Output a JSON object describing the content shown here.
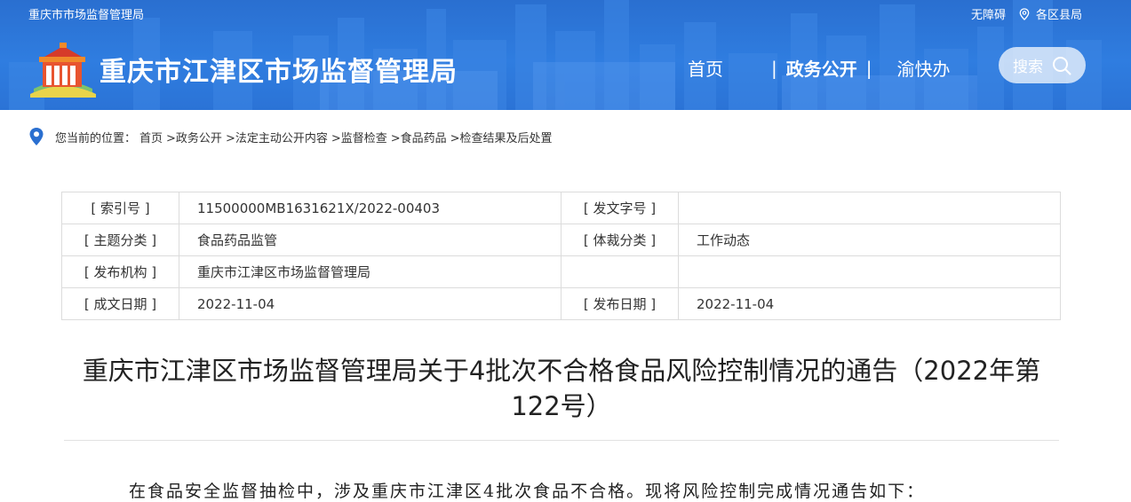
{
  "header": {
    "top_site_name": "重庆市市场监督管理局",
    "accessibility": "无障碍",
    "districts": "各区县局",
    "site_title": "重庆市江津区市场监督管理局",
    "nav": {
      "home": "首页",
      "separator": "|",
      "gov_open": "政务公开",
      "yukuaiban": "渝快办"
    },
    "search_label": "搜索"
  },
  "breadcrumb": {
    "prefix": "您当前的位置：",
    "items": [
      "首页",
      ">政务公开",
      ">法定主动公开内容",
      ">监督检查",
      ">食品药品",
      ">检查结果及后处置"
    ]
  },
  "meta_table": {
    "rows": [
      {
        "k1": "[ 索引号 ]",
        "v1": "11500000MB1631621X/2022-00403",
        "k2": "[ 发文字号 ]",
        "v2": ""
      },
      {
        "k1": "[ 主题分类 ]",
        "v1": "食品药品监管",
        "k2": "[ 体裁分类 ]",
        "v2": "工作动态"
      },
      {
        "k1": "[ 发布机构 ]",
        "v1": "重庆市江津区市场监督管理局",
        "k2": "",
        "v2": ""
      },
      {
        "k1": "[ 成文日期 ]",
        "v1": "2022-11-04",
        "k2": "[ 发布日期 ]",
        "v2": "2022-11-04"
      }
    ]
  },
  "article": {
    "title_line1": "重庆市江津区市场监督管理局关于4批次不合格食品风险控制情况的通告（2022年第",
    "title_line2": "122号）",
    "intro": "在食品安全监督抽检中，涉及重庆市江津区4批次食品不合格。现将风险控制完成情况通告如下："
  },
  "colors": {
    "header_blue": "#2f7de0",
    "pin_blue": "#2a6fd0"
  }
}
